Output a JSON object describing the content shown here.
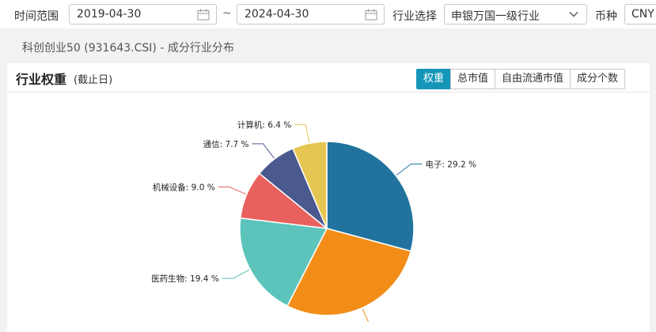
{
  "filters": {
    "date_range_label": "时间范围",
    "start_date": "2019-04-30",
    "separator": "~",
    "end_date": "2024-04-30",
    "industry_label": "行业选择",
    "industry_value": "申银万国一级行业",
    "currency_label": "币种",
    "currency_value": "CNY"
  },
  "subtitle": "科创创业50 (931643.CSI) - 成分行业分布",
  "panel": {
    "title": "行业权重",
    "subtitle": "(截止日)",
    "tabs": [
      {
        "label": "权重",
        "active": true
      },
      {
        "label": "总市值",
        "active": false
      },
      {
        "label": "自由流通市值",
        "active": false
      },
      {
        "label": "成分个数",
        "active": false
      }
    ]
  },
  "colors": {
    "accent": "#1596b8"
  },
  "chart_data": {
    "type": "pie",
    "slices": [
      {
        "name": "电子",
        "value": 29.2,
        "label": "电子: 29.2 %",
        "color": "#21739e"
      },
      {
        "name": "",
        "value": 28.3,
        "label": "",
        "color": "#f28e18"
      },
      {
        "name": "医药生物",
        "value": 19.4,
        "label": "医药生物: 19.4 %",
        "color": "#5cc4bb"
      },
      {
        "name": "机械设备",
        "value": 9.0,
        "label": "机械设备: 9.0 %",
        "color": "#e8615e"
      },
      {
        "name": "通信",
        "value": 7.7,
        "label": "通信: 7.7 %",
        "color": "#4a5a8f"
      },
      {
        "name": "计算机",
        "value": 6.4,
        "label": "计算机: 6.4 %",
        "color": "#e6c652"
      }
    ]
  }
}
